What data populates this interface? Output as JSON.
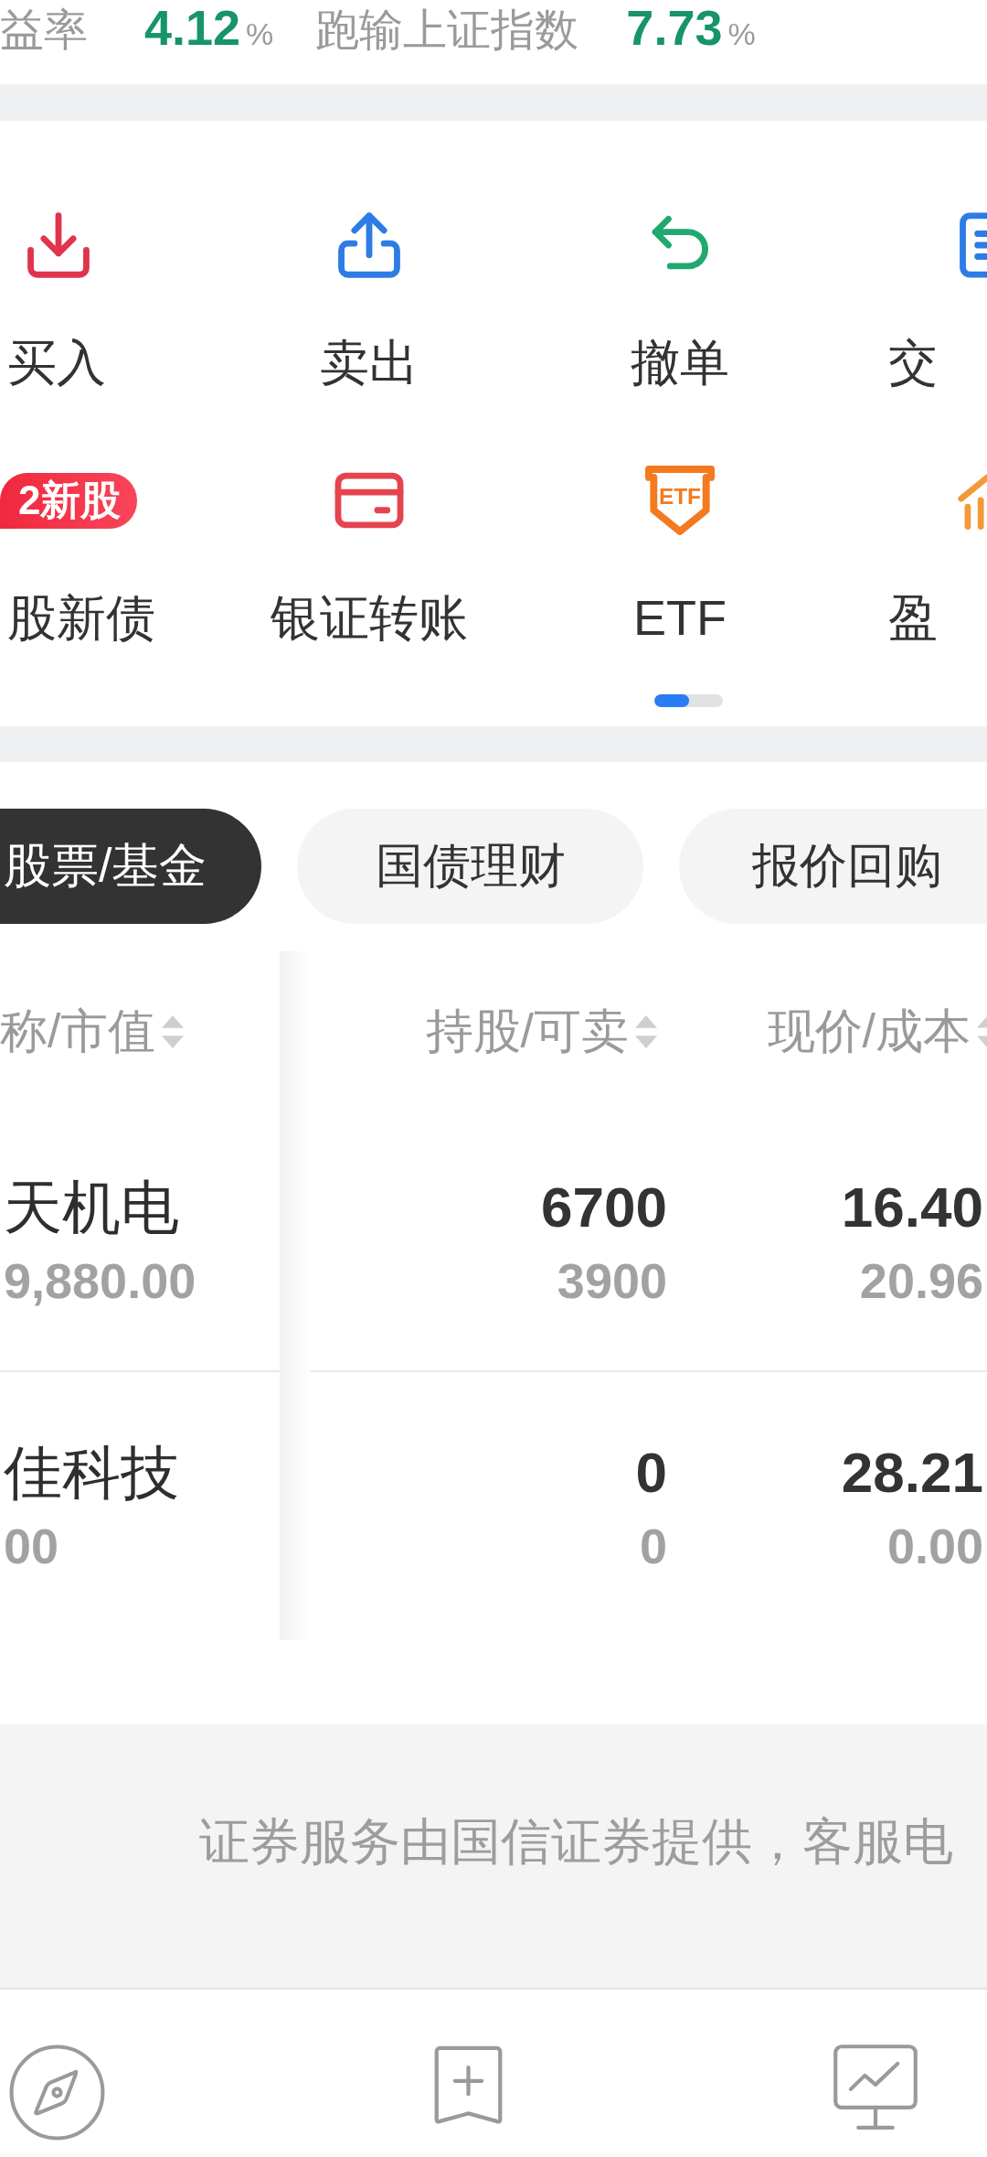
{
  "summary": {
    "return_label": "益率",
    "return_value": "4.12",
    "return_unit": "%",
    "compare_label": "跑输上证指数",
    "compare_value": "7.73",
    "compare_unit": "%"
  },
  "shortcuts": [
    {
      "label": "买入"
    },
    {
      "label": "卖出"
    },
    {
      "label": "撤单"
    },
    {
      "label": "交"
    },
    {
      "label": "股新债",
      "badge": "2新股"
    },
    {
      "label": "银证转账"
    },
    {
      "label": "ETF",
      "icon_text": "ETF"
    },
    {
      "label": "盈"
    }
  ],
  "shortcut_pager": {
    "level": 0.5
  },
  "tabs": [
    {
      "label": "股票/基金",
      "selected": true
    },
    {
      "label": "国债理财",
      "selected": false
    },
    {
      "label": "报价回购",
      "selected": false
    }
  ],
  "holdings": {
    "columns": [
      "称/市值",
      "持股/可卖",
      "现价/成本"
    ],
    "rows": [
      {
        "name": "天机电",
        "market_value": "9,880.00",
        "shares": "6700",
        "sellable": "3900",
        "price": "16.40",
        "cost": "20.96"
      },
      {
        "name": "佳科技",
        "market_value": "00",
        "shares": "0",
        "sellable": "0",
        "price": "28.21",
        "cost": "0.00"
      }
    ]
  },
  "footer": {
    "notice": "证券服务由国信证券提供，客服电"
  }
}
